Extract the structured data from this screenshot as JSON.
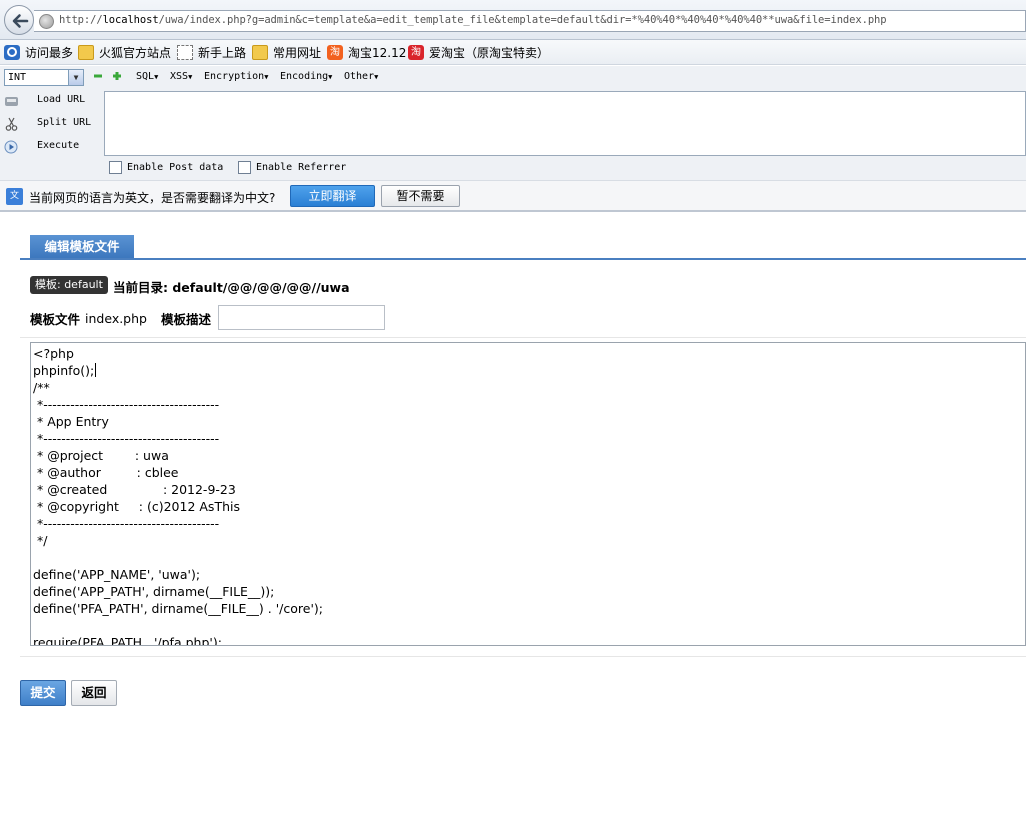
{
  "browser": {
    "url_prefix": "http://",
    "url_host": "localhost",
    "url_rest": "/uwa/index.php?g=admin&c=template&a=edit_template_file&template=default&dir=*%40%40*%40%40*%40%40**uwa&file=index.php"
  },
  "bookmarks": [
    {
      "label": "访问最多",
      "icon": "most-visited-icon"
    },
    {
      "label": "火狐官方站点",
      "icon": "folder-icon"
    },
    {
      "label": "新手上路",
      "icon": "page-icon"
    },
    {
      "label": "常用网址",
      "icon": "folder-icon"
    },
    {
      "label": "淘宝12.12",
      "icon": "taobao-icon",
      "icon_text": "淘"
    },
    {
      "label": "爱淘宝（原淘宝特卖）",
      "icon": "aitaobao-icon",
      "icon_text": "淘"
    }
  ],
  "hackbar": {
    "select_value": "INT",
    "menus": [
      "SQL",
      "XSS",
      "Encryption",
      "Encoding",
      "Other"
    ],
    "actions": [
      "Load URL",
      "Split URL",
      "Execute"
    ],
    "checkboxes": [
      "Enable Post data",
      "Enable Referrer"
    ]
  },
  "translate": {
    "icon_text": "文",
    "message": "当前网页的语言为英文，是否需要翻译为中文?",
    "translate_label": "立即翻译",
    "decline_label": "暂不需要"
  },
  "page": {
    "tab_label": "编辑模板文件",
    "template_badge": "模板: default",
    "current_dir": "当前目录: default/@@/@@/@@//uwa",
    "file_label": "模板文件",
    "file_name": "index.php",
    "desc_label": "模板描述",
    "desc_value": "",
    "code_lines": [
      "<?php",
      "phpinfo();",
      "/**",
      " *---------------------------------------",
      " * App Entry",
      " *---------------------------------------",
      " * @project        : uwa",
      " * @author         : cblee",
      " * @created              : 2012-9-23",
      " * @copyright     : (c)2012 AsThis",
      " *---------------------------------------",
      " */",
      "",
      "define('APP_NAME', 'uwa');",
      "define('APP_PATH', dirname(__FILE__));",
      "define('PFA_PATH', dirname(__FILE__) . '/core');",
      "",
      "require(PFA_PATH . '/pfa.php');"
    ],
    "submit_label": "提交",
    "back_label": "返回"
  }
}
